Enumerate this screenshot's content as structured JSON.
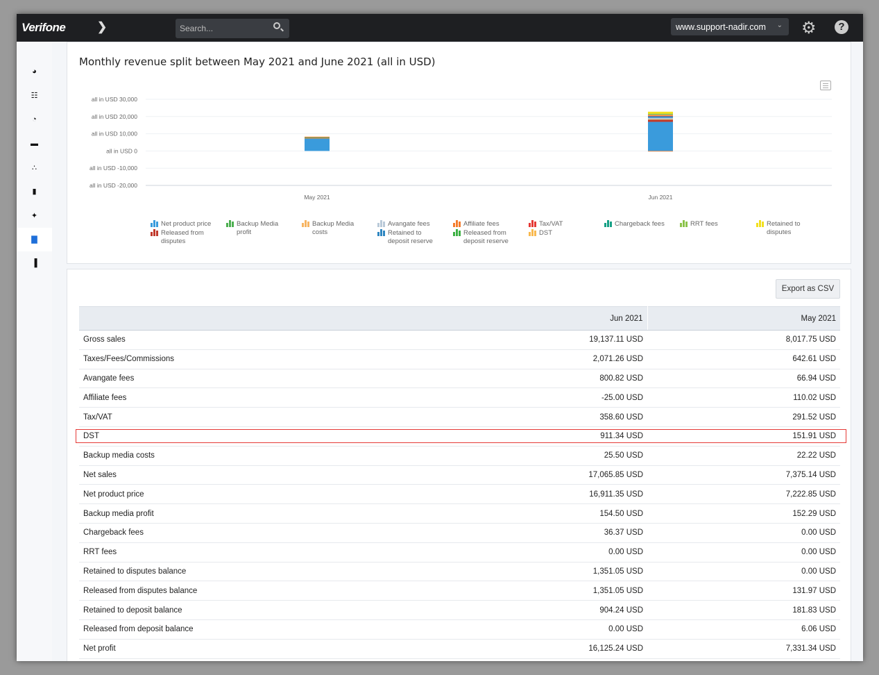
{
  "header": {
    "logo": "Verifone",
    "search_placeholder": "Search...",
    "domain": "www.support-nadir.com"
  },
  "sidebar": {
    "items": [
      {
        "icon": "dashboard-icon"
      },
      {
        "icon": "sliders-icon"
      },
      {
        "icon": "pie-chart-icon"
      },
      {
        "icon": "handshake-icon"
      },
      {
        "icon": "sitemap-icon"
      },
      {
        "icon": "database-icon"
      },
      {
        "icon": "plug-icon"
      },
      {
        "icon": "bar-chart-icon",
        "active": true
      },
      {
        "icon": "reports-icon"
      }
    ]
  },
  "chart_data": {
    "type": "bar",
    "stacked": true,
    "title": "Monthly revenue split between May 2021 and June 2021 (all in USD)",
    "categories": [
      "May 2021",
      "Jun 2021"
    ],
    "ylim": [
      -20000,
      30000
    ],
    "yticks": [
      "all in USD 30,000",
      "all in USD 20,000",
      "all in USD 10,000",
      "all in USD 0",
      "all in USD -10,000",
      "all in USD -20,000"
    ],
    "ytick_values": [
      30000,
      20000,
      10000,
      0,
      -10000,
      -20000
    ],
    "grid": true,
    "legend_position": "bottom",
    "series": [
      {
        "name": "Net product price",
        "color": "#3a9bdc",
        "values": [
          7222.85,
          16911.35
        ]
      },
      {
        "name": "Released from disputes",
        "color": "#c0392b",
        "values": [
          131.97,
          1351.05
        ]
      },
      {
        "name": "Backup Media profit",
        "color": "#4caf50",
        "values": [
          152.29,
          154.5
        ]
      },
      {
        "name": "Backup Media costs",
        "color": "#f7b461",
        "values": [
          22.22,
          25.5
        ]
      },
      {
        "name": "Avangate fees",
        "color": "#b9c9d8",
        "values": [
          66.94,
          800.82
        ]
      },
      {
        "name": "Retained to deposit reserve",
        "color": "#2e86c1",
        "values": [
          181.83,
          904.24
        ]
      },
      {
        "name": "Affiliate fees",
        "color": "#f47c2c",
        "values": [
          110.02,
          -25.0
        ]
      },
      {
        "name": "Released from deposit reserve",
        "color": "#3cb043",
        "values": [
          6.06,
          0.0
        ]
      },
      {
        "name": "Tax/VAT",
        "color": "#e53935",
        "values": [
          291.52,
          358.6
        ]
      },
      {
        "name": "DST",
        "color": "#f9b94f",
        "values": [
          151.91,
          911.34
        ]
      },
      {
        "name": "Chargeback fees",
        "color": "#16a085",
        "values": [
          0.0,
          36.37
        ]
      },
      {
        "name": "RRT fees",
        "color": "#8bc34a",
        "values": [
          0.0,
          0.0
        ]
      },
      {
        "name": "Retained to disputes",
        "color": "#f2e01e",
        "values": [
          0.0,
          1351.05
        ]
      }
    ]
  },
  "legend_columns": [
    [
      0,
      1
    ],
    [
      2
    ],
    [
      3
    ],
    [
      4,
      5
    ],
    [
      6,
      7
    ],
    [
      8,
      9
    ],
    [
      10
    ],
    [
      11
    ],
    [
      12
    ]
  ],
  "table": {
    "export_label": "Export as CSV",
    "columns": [
      "",
      "Jun 2021",
      "May 2021"
    ],
    "rows": [
      [
        "Gross sales",
        "19,137.11 USD",
        "8,017.75 USD"
      ],
      [
        "Taxes/Fees/Commissions",
        "2,071.26 USD",
        "642.61 USD"
      ],
      [
        "Avangate fees",
        "800.82 USD",
        "66.94 USD"
      ],
      [
        "Affiliate fees",
        "-25.00 USD",
        "110.02 USD"
      ],
      [
        "Tax/VAT",
        "358.60 USD",
        "291.52 USD"
      ],
      [
        "DST",
        "911.34 USD",
        "151.91 USD"
      ],
      [
        "Backup media costs",
        "25.50 USD",
        "22.22 USD"
      ],
      [
        "Net sales",
        "17,065.85 USD",
        "7,375.14 USD"
      ],
      [
        "Net product price",
        "16,911.35 USD",
        "7,222.85 USD"
      ],
      [
        "Backup media profit",
        "154.50 USD",
        "152.29 USD"
      ],
      [
        "Chargeback fees",
        "36.37 USD",
        "0.00 USD"
      ],
      [
        "RRT fees",
        "0.00 USD",
        "0.00 USD"
      ],
      [
        "Retained to disputes balance",
        "1,351.05 USD",
        "0.00 USD"
      ],
      [
        "Released from disputes balance",
        "1,351.05 USD",
        "131.97 USD"
      ],
      [
        "Retained to deposit balance",
        "904.24 USD",
        "181.83 USD"
      ],
      [
        "Released from deposit balance",
        "0.00 USD",
        "6.06 USD"
      ],
      [
        "Net profit",
        "16,125.24 USD",
        "7,331.34 USD"
      ]
    ],
    "highlighted_row": "DST"
  }
}
